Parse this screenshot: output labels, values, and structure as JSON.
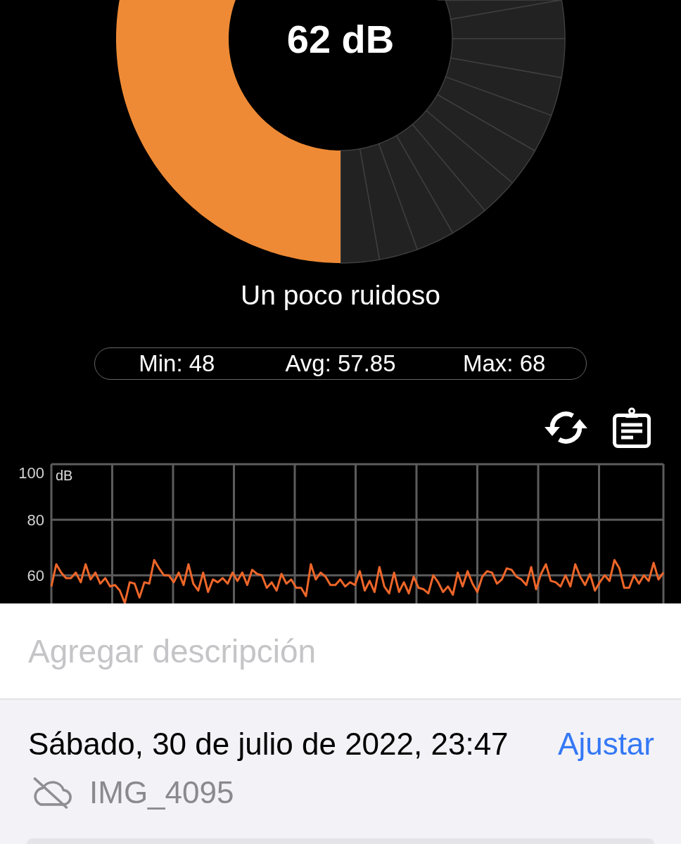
{
  "meter": {
    "reading": "62 dB",
    "level": 0.5,
    "status": "Un poco ruidoso"
  },
  "stats": [
    "Min: 48",
    "Avg: 57.85",
    "Max: 68"
  ],
  "chart": {
    "chart_data": {
      "type": "line",
      "ylabel": "dB",
      "ylim": [
        50,
        100
      ],
      "yticks": [
        60,
        80,
        100
      ],
      "values": [
        56,
        64,
        61,
        59,
        59,
        61,
        57.5,
        64,
        58.5,
        61,
        57,
        59,
        56,
        56.5,
        54.5,
        50,
        57.5,
        57,
        52,
        57.5,
        57,
        65.5,
        62.5,
        60,
        60,
        57.5,
        61,
        56.5,
        64,
        57,
        54.5,
        61,
        54,
        58.5,
        57.5,
        59,
        57,
        61,
        58,
        61,
        56.5,
        62,
        60.5,
        60,
        55.5,
        57.5,
        54.5,
        60.5,
        57,
        58.5,
        55.5,
        55.5,
        52.5,
        64,
        58.5,
        61,
        59.5,
        56.5,
        56.5,
        58.5,
        56,
        57.5,
        56.5,
        61.5,
        54.5,
        58,
        54,
        63,
        56,
        53.5,
        61,
        54,
        57.5,
        53.5,
        59.5,
        55.5,
        55,
        53.5,
        60,
        57.5,
        54,
        56,
        53,
        61,
        56,
        61.5,
        57,
        54,
        59.5,
        61.5,
        61,
        57,
        58.5,
        62.5,
        62,
        59.5,
        58.5,
        56.5,
        63,
        55,
        60.5,
        64,
        58,
        57.5,
        56,
        60,
        56,
        64,
        59.5,
        56.5,
        60.5,
        54.5,
        57.5,
        60,
        58,
        65.5,
        62.5,
        55.5,
        55.5,
        60,
        57,
        60,
        58,
        64.5,
        58.5,
        61
      ]
    }
  },
  "photo_info": {
    "description": {
      "placeholder": "Agregar descripción"
    },
    "date": "Sábado, 30 de julio de 2022, 23:47",
    "adjust_button": "Ajustar",
    "filename": "IMG_4095"
  }
}
